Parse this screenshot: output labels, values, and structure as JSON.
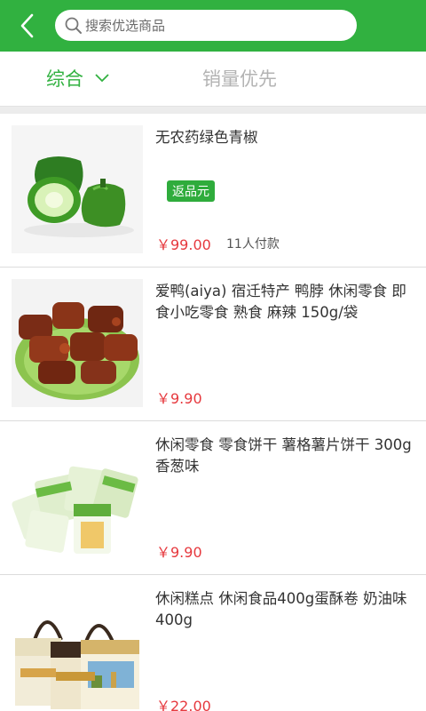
{
  "header": {
    "search_placeholder": "搜索优选商品"
  },
  "tabs": [
    {
      "label": "综合",
      "active": true
    },
    {
      "label": "销量优先",
      "active": false
    }
  ],
  "colors": {
    "brand": "#31b140",
    "price": "#e6393e",
    "inactive_tab": "#b3b3b3"
  },
  "products": [
    {
      "title": "无农药绿色青椒",
      "badge": "返品元",
      "price": "￥99.00",
      "buyers": "11人付款"
    },
    {
      "title": "爱鸭(aiya) 宿迁特产 鸭脖 休闲零食 即食小吃零食 熟食 麻辣 150g/袋",
      "price": "￥9.90"
    },
    {
      "title": "休闲零食 零食饼干 薯格薯片饼干 300g 香葱味",
      "price": "￥9.90"
    },
    {
      "title": "休闲糕点 休闲食品400g蛋酥卷 奶油味 400g",
      "price": "￥22.00"
    }
  ]
}
